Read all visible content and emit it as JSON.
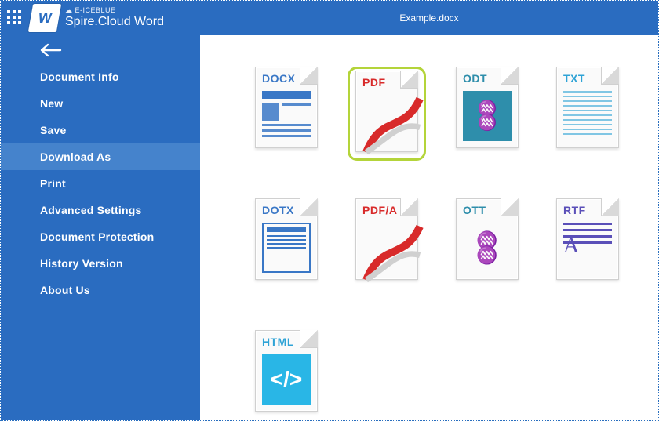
{
  "brand": {
    "vendor": "E-ICEBLUE",
    "name": "Spire.Cloud Word",
    "logo_letter": "W"
  },
  "header": {
    "document_title": "Example.docx"
  },
  "sidebar": {
    "items": [
      {
        "id": "doc-info",
        "label": "Document Info"
      },
      {
        "id": "new",
        "label": "New"
      },
      {
        "id": "save",
        "label": "Save"
      },
      {
        "id": "download",
        "label": "Download As"
      },
      {
        "id": "print",
        "label": "Print"
      },
      {
        "id": "advanced",
        "label": "Advanced Settings"
      },
      {
        "id": "protect",
        "label": "Document Protection"
      },
      {
        "id": "history",
        "label": "History Version"
      },
      {
        "id": "about",
        "label": "About Us"
      }
    ],
    "active_id": "download"
  },
  "formats": {
    "selected_id": "pdf",
    "items": [
      {
        "id": "docx",
        "label": "DOCX",
        "label_color": "c-blue"
      },
      {
        "id": "pdf",
        "label": "PDF",
        "label_color": "c-red"
      },
      {
        "id": "odt",
        "label": "ODT",
        "label_color": "c-teal"
      },
      {
        "id": "txt",
        "label": "TXT",
        "label_color": "c-lblue"
      },
      {
        "id": "dotx",
        "label": "DOTX",
        "label_color": "c-blue"
      },
      {
        "id": "pdfa",
        "label": "PDF/A",
        "label_color": "c-red"
      },
      {
        "id": "ott",
        "label": "OTT",
        "label_color": "c-teal"
      },
      {
        "id": "rtf",
        "label": "RTF",
        "label_color": "c-purple"
      },
      {
        "id": "html",
        "label": "HTML",
        "label_color": "c-lblue"
      }
    ]
  }
}
